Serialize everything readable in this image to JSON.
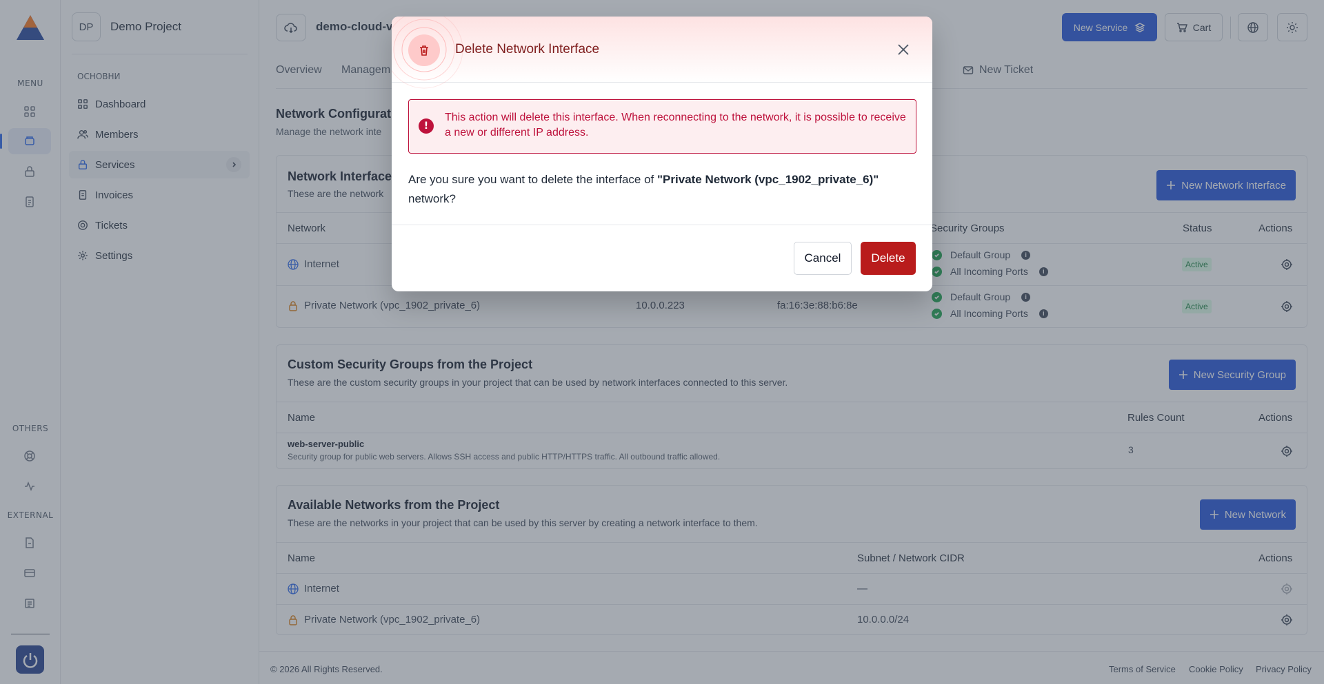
{
  "rail": {
    "menu_label": "MENU",
    "others_label": "OTHERS",
    "external_label": "EXTERNAL"
  },
  "sidebar": {
    "project_initials": "DP",
    "project_name": "Demo Project",
    "section_caption": "ОСНОВНИ",
    "items": [
      {
        "label": "Dashboard"
      },
      {
        "label": "Members"
      },
      {
        "label": "Services"
      },
      {
        "label": "Invoices"
      },
      {
        "label": "Tickets"
      },
      {
        "label": "Settings"
      }
    ]
  },
  "header": {
    "server_name": "demo-cloud-v",
    "new_service_label": "New Service",
    "cart_label": "Cart"
  },
  "tabs": [
    "Overview",
    "Managem",
    "New Ticket"
  ],
  "page": {
    "title": "Network Configurat",
    "subtitle": "Manage the network inte"
  },
  "interfaces": {
    "title": "Network Interface",
    "subtitle": "These are the network",
    "add_label": "New Network Interface",
    "columns": [
      "Network",
      "Security Groups",
      "Status",
      "Actions"
    ],
    "rows": [
      {
        "network": "Internet",
        "ip": "",
        "mac": "",
        "groups": [
          "Default Group",
          "All Incoming Ports"
        ],
        "status": "Active"
      },
      {
        "network": "Private Network (vpc_1902_private_6)",
        "ip": "10.0.0.223",
        "mac": "fa:16:3e:88:b6:8e",
        "groups": [
          "Default Group",
          "All Incoming Ports"
        ],
        "status": "Active"
      }
    ]
  },
  "security_groups": {
    "title": "Custom Security Groups from the Project",
    "subtitle": "These are the custom security groups in your project that can be used by network interfaces connected to this server.",
    "add_label": "New Security Group",
    "columns": [
      "Name",
      "Rules Count",
      "Actions"
    ],
    "rows": [
      {
        "name": "web-server-public",
        "description": "Security group for public web servers. Allows SSH access and public HTTP/HTTPS traffic. All outbound traffic allowed.",
        "rules": "3"
      }
    ]
  },
  "networks": {
    "title": "Available Networks from the Project",
    "subtitle": "These are the networks in your project that can be used by this server by creating a network interface to them.",
    "add_label": "New Network",
    "columns": [
      "Name",
      "Subnet / Network CIDR",
      "Actions"
    ],
    "rows": [
      {
        "name": "Internet",
        "cidr": "—"
      },
      {
        "name": "Private Network (vpc_1902_private_6)",
        "cidr": "10.0.0.0/24"
      }
    ]
  },
  "footer": {
    "copyright": "© 2026 All Rights Reserved.",
    "links": [
      "Terms of Service",
      "Cookie Policy",
      "Privacy Policy"
    ]
  },
  "modal": {
    "title": "Delete Network Interface",
    "alert": "This action will delete this interface. When reconnecting to the network, it is possible to receive a new or different IP address.",
    "question_prefix": "Are you sure you want to delete the interface of ",
    "question_target": "\"Private Network (vpc_1902_private_6)\"",
    "question_suffix": " network?",
    "cancel_label": "Cancel",
    "delete_label": "Delete"
  },
  "colors": {
    "primary": "#1d4ed8",
    "danger": "#b91c1c",
    "success": "#16a34a"
  }
}
